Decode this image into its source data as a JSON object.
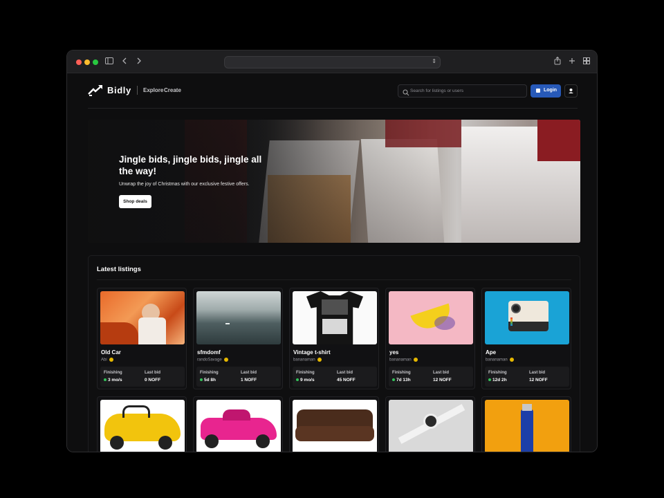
{
  "browser": {
    "traffic_lights": [
      "#ff5f57",
      "#febc2e",
      "#28c840"
    ],
    "icons": [
      "sidebar-icon",
      "back-icon",
      "forward-icon",
      "share-icon",
      "new-tab-icon",
      "tab-overview-icon"
    ]
  },
  "nav": {
    "logo_text": "Bidly",
    "links": [
      "Explore",
      "Create"
    ],
    "search_placeholder": "Search for listings or users",
    "login_label": "Login"
  },
  "hero": {
    "title": "Jingle bids, jingle bids, jingle all the way!",
    "subtitle": "Unwrap the joy of Christmas with our exclusive festive offers.",
    "button": "Shop deals"
  },
  "listings": {
    "title": "Latest listings",
    "finishing_label": "Finishing",
    "last_bid_label": "Last bid",
    "items": [
      {
        "title": "Old Car",
        "seller": "Abi",
        "finishing": "3 mo/s",
        "last_bid": "0 NOFF"
      },
      {
        "title": "sfmdomf",
        "seller": "randoSavage",
        "finishing": "5d 8h",
        "last_bid": "1 NOFF"
      },
      {
        "title": "Vintage t-shirt",
        "seller": "bananaman",
        "finishing": "9 mo/s",
        "last_bid": "45 NOFF"
      },
      {
        "title": "yes",
        "seller": "bananaman",
        "finishing": "7d 13h",
        "last_bid": "12 NOFF"
      },
      {
        "title": "Ape",
        "seller": "bananaman",
        "finishing": "12d 2h",
        "last_bid": "12 NOFF"
      }
    ],
    "second_row": [
      "yellow-toy-car-image",
      "pink-toy-car-image",
      "leather-sofa-image",
      "smartwatch-image",
      "lighter-image"
    ]
  }
}
